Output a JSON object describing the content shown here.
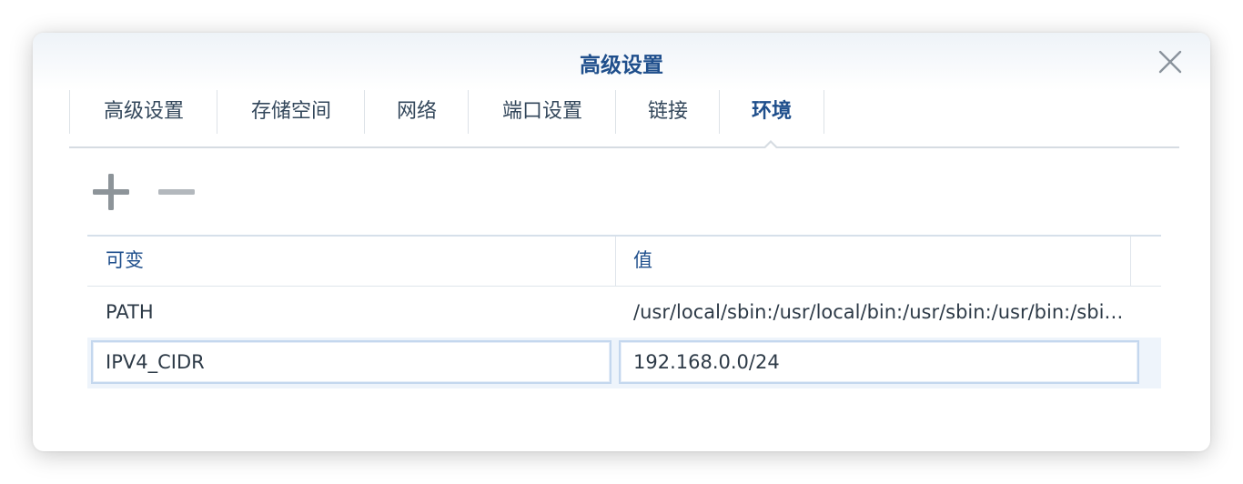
{
  "dialog": {
    "title": "高级设置"
  },
  "tabs": [
    {
      "label": "高级设置"
    },
    {
      "label": "存储空间"
    },
    {
      "label": "网络"
    },
    {
      "label": "端口设置"
    },
    {
      "label": "链接"
    },
    {
      "label": "环境",
      "active": true
    }
  ],
  "toolbar": {
    "add_icon": "plus-icon",
    "remove_icon": "minus-icon"
  },
  "grid": {
    "columns": [
      "可变",
      "值"
    ],
    "rows": [
      {
        "variable": "PATH",
        "value": "/usr/local/sbin:/usr/local/bin:/usr/sbin:/usr/bin:/sbin:/bin"
      },
      {
        "variable": "IPV4_CIDR",
        "value": "192.168.0.0/24",
        "editing": true
      }
    ]
  },
  "colors": {
    "accent": "#1f4f8c",
    "text": "#2d3a47",
    "border": "#d6dce2"
  }
}
